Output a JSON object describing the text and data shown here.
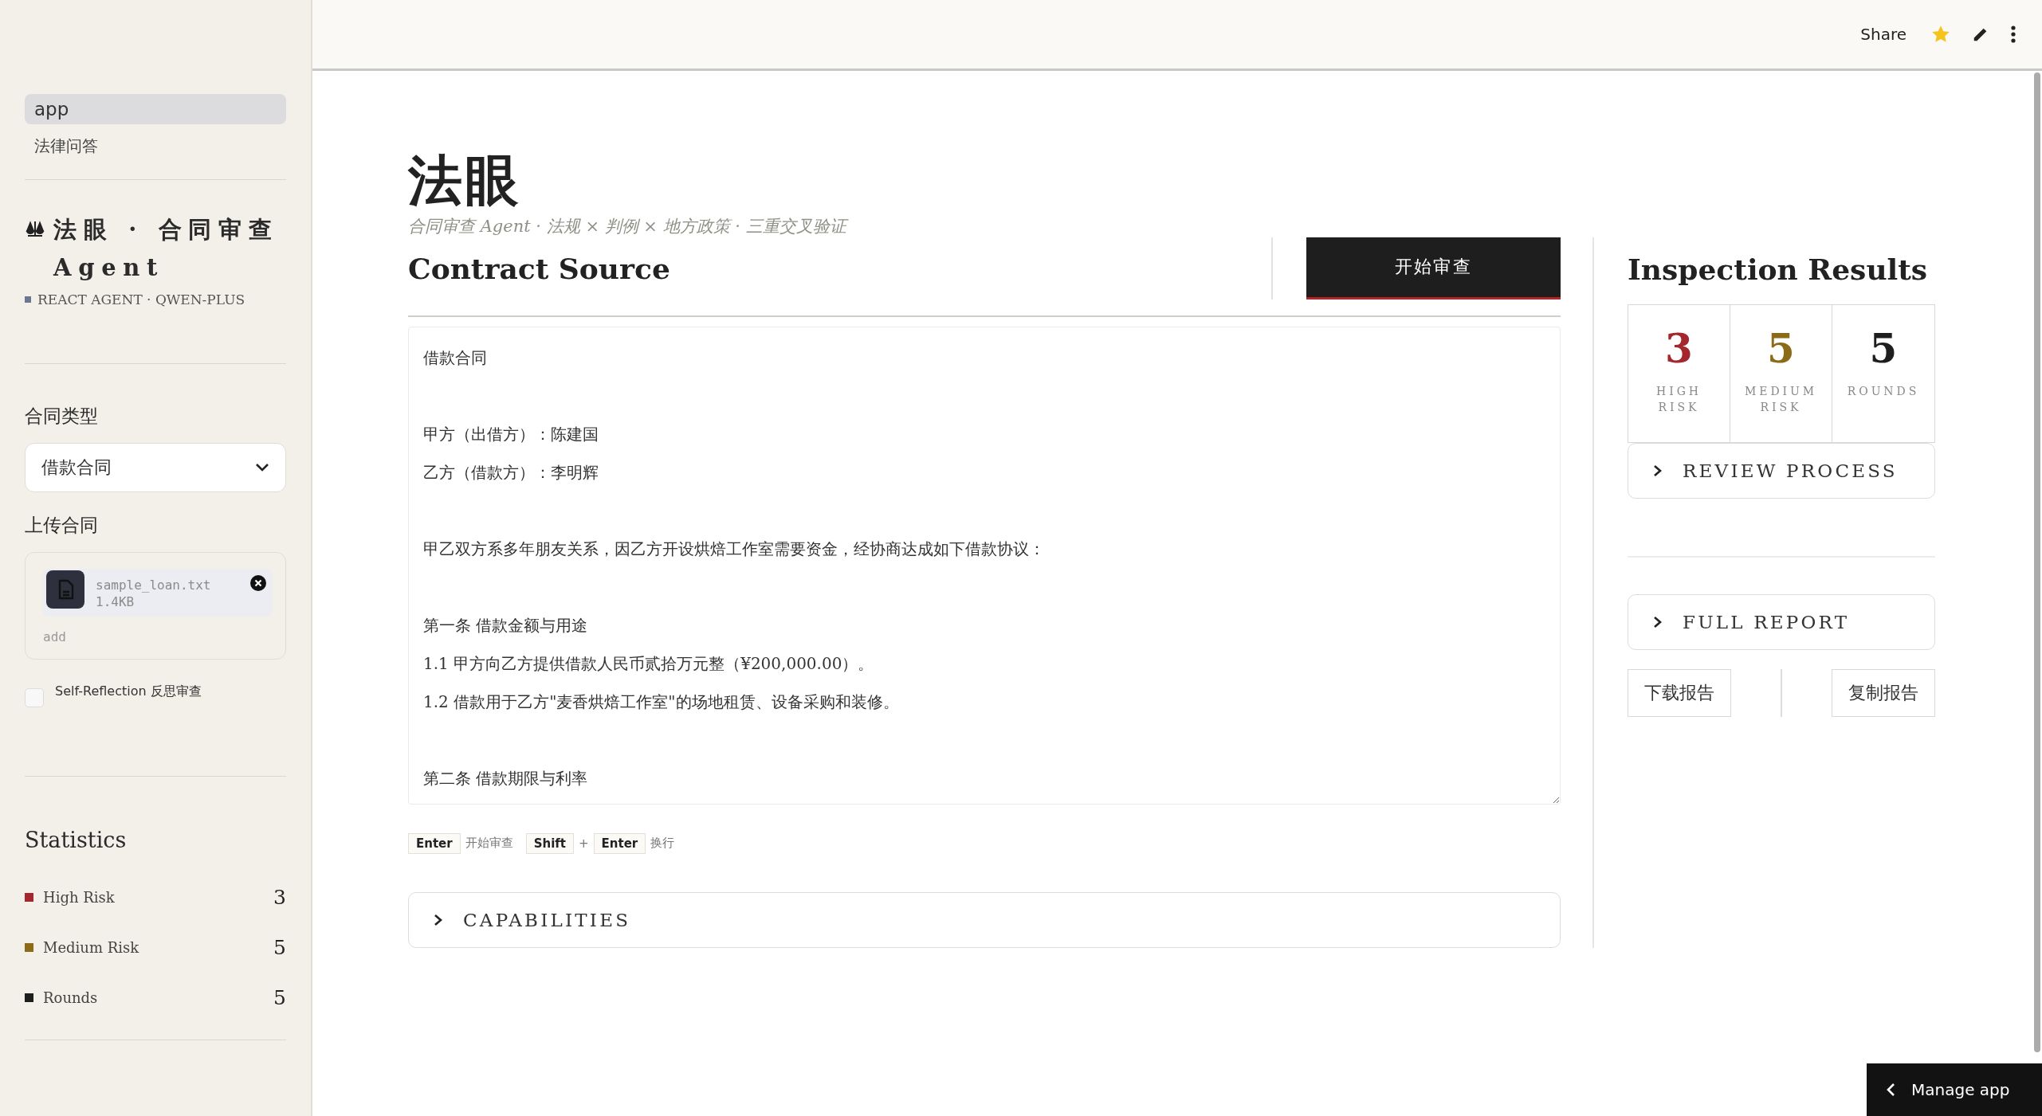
{
  "toolbar": {
    "share": "Share"
  },
  "sidebar": {
    "nav": [
      {
        "label": "app",
        "selected": true
      },
      {
        "label": "法律问答",
        "selected": false
      }
    ],
    "brand_title": "法眼 · 合同审查 Agent",
    "brand_tag": "REACT AGENT · QWEN-PLUS",
    "contract_type": {
      "label": "合同类型",
      "value": "借款合同"
    },
    "upload": {
      "label": "上传合同",
      "file_name": "sample_loan.txt",
      "file_size": "1.4KB",
      "add": "add"
    },
    "self_reflection": {
      "label": "Self-Reflection 反思审查",
      "checked": false
    },
    "statistics": {
      "title": "Statistics",
      "rows": [
        {
          "label": "High Risk",
          "value": "3",
          "color": "#a3272d"
        },
        {
          "label": "Medium Risk",
          "value": "5",
          "color": "#8b6b17"
        },
        {
          "label": "Rounds",
          "value": "5",
          "color": "#1e1e1e"
        }
      ]
    }
  },
  "main": {
    "title": "法眼",
    "subtitle": "合同审查 Agent · 法规 × 判例 × 地方政策 · 三重交叉验证",
    "source": {
      "title": "Contract Source",
      "start_button": "开始审查",
      "contract_paragraphs": [
        [
          "借款合同"
        ],
        [
          "甲方（出借方）：陈建国",
          "乙方（借款方）：李明辉"
        ],
        [
          "甲乙双方系多年朋友关系，因乙方开设烘焙工作室需要资金，经协商达成如下借款协议："
        ],
        [
          "第一条 借款金额与用途",
          "1.1 甲方向乙方提供借款人民币贰拾万元整（¥200,000.00）。",
          "1.2 借款用于乙方\"麦香烘焙工作室\"的场地租赁、设备采购和装修。"
        ],
        [
          "第二条 借款期限与利率"
        ]
      ]
    },
    "hotkeys": [
      {
        "keys": [
          "Enter"
        ],
        "description": "开始审查"
      },
      {
        "keys": [
          "Shift",
          "Enter"
        ],
        "joiner": "+",
        "description": "换行"
      }
    ],
    "capabilities": {
      "label": "CAPABILITIES",
      "expanded": false
    }
  },
  "results": {
    "title": "Inspection Results",
    "metrics": [
      {
        "value": "3",
        "label": "HIGH RISK",
        "color": "#a3272d"
      },
      {
        "value": "5",
        "label": "MEDIUM RISK",
        "color": "#8b6b17"
      },
      {
        "value": "5",
        "label": "ROUNDS",
        "color": "#1e1e1e"
      }
    ],
    "review_process": {
      "label": "REVIEW PROCESS",
      "expanded": false
    },
    "full_report": {
      "label": "FULL REPORT",
      "expanded": false
    },
    "buttons": [
      "下载报告",
      "复制报告"
    ]
  },
  "manage_app": "Manage app"
}
